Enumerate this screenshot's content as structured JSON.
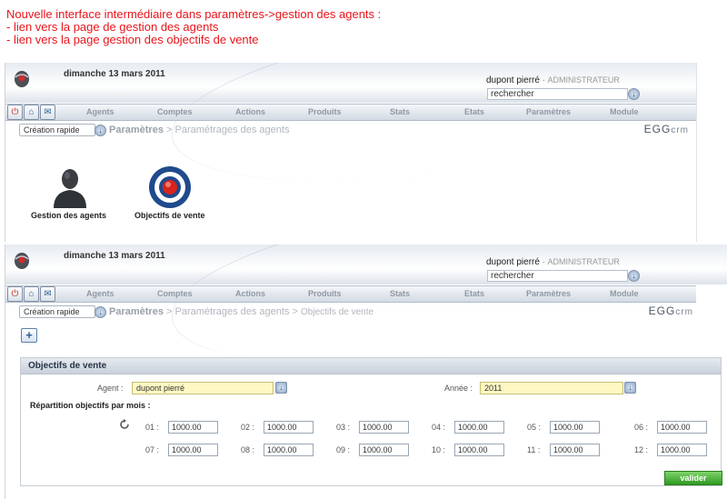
{
  "note": {
    "title": "Nouvelle interface intermédiaire dans paramètres->gestion des agents  :",
    "line1": "- lien vers la page de gestion des agents",
    "line2": "- lien vers la page gestion des objectifs de vente"
  },
  "header": {
    "date": "dimanche 13 mars 2011",
    "user": "dupont pierré",
    "separator": "-",
    "role": "ADMINISTRATEUR",
    "search_value": "rechercher",
    "brand_main": "EGG",
    "brand_sub": "crm"
  },
  "nav": [
    "Agents",
    "Comptes",
    "Actions",
    "Produits",
    "Stats",
    "Etats",
    "Paramètres",
    "Module"
  ],
  "quick_create": "Création rapide",
  "crumbs1": {
    "root": "Paramètres",
    "sep": ">",
    "page": "Paramétrages des agents"
  },
  "crumbs2": {
    "root": "Paramètres",
    "sep1": ">",
    "page": "Paramétrages des agents",
    "sep2": ">",
    "sub": "Objectifs de vente"
  },
  "tiles": {
    "agents": "Gestion des agents",
    "objectifs": "Objectifs de vente"
  },
  "form": {
    "title": "Objectifs de vente",
    "agent_label": "Agent :",
    "agent_value": "dupont pierré",
    "year_label": "Année :",
    "year_value": "2011",
    "repartition": "Répartition objectifs par mois :",
    "months": [
      {
        "label": "01 :",
        "value": "1000.00"
      },
      {
        "label": "02 :",
        "value": "1000.00"
      },
      {
        "label": "03 :",
        "value": "1000.00"
      },
      {
        "label": "04 :",
        "value": "1000.00"
      },
      {
        "label": "05 :",
        "value": "1000.00"
      },
      {
        "label": "06 :",
        "value": "1000.00"
      },
      {
        "label": "07 :",
        "value": "1000.00"
      },
      {
        "label": "08 :",
        "value": "1000.00"
      },
      {
        "label": "09 :",
        "value": "1000.00"
      },
      {
        "label": "10 :",
        "value": "1000.00"
      },
      {
        "label": "11 :",
        "value": "1000.00"
      },
      {
        "label": "12 :",
        "value": "1000.00"
      }
    ],
    "submit": "valider",
    "plus": "+"
  },
  "colors": {
    "note_red": "#e8141a",
    "valider_green": "#2f9a21"
  },
  "icons": [
    "logo-icon",
    "power-icon",
    "home-icon",
    "mail-icon",
    "dropdown-icon",
    "agent-icon",
    "target-icon",
    "refresh-icon"
  ]
}
